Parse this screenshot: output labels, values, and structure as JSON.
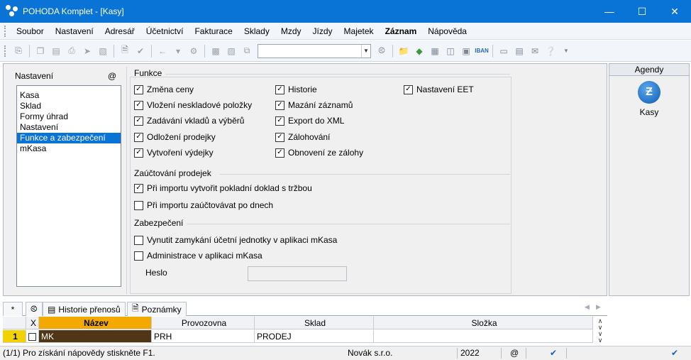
{
  "window": {
    "title": "POHODA Komplet - [Kasy]"
  },
  "menu": [
    "Soubor",
    "Nastavení",
    "Adresář",
    "Účetnictví",
    "Fakturace",
    "Sklady",
    "Mzdy",
    "Jízdy",
    "Majetek",
    "Záznam",
    "Nápověda"
  ],
  "menu_bold_index": 9,
  "left_panel": {
    "header": "Nastavení",
    "at_label": "@",
    "items": [
      "Kasa",
      "Sklad",
      "Formy úhrad",
      "Nastavení",
      "Funkce a zabezpečení",
      "mKasa"
    ],
    "selected_index": 4
  },
  "form": {
    "funkce": {
      "title": "Funkce",
      "options": [
        {
          "label": "Změna ceny",
          "checked": true
        },
        {
          "label": "Vložení neskladové položky",
          "checked": true
        },
        {
          "label": "Zadávání vkladů a výběrů",
          "checked": true
        },
        {
          "label": "Odložení prodejky",
          "checked": true
        },
        {
          "label": "Vytvoření výdejky",
          "checked": true
        },
        {
          "label": "Historie",
          "checked": true
        },
        {
          "label": "Mazání záznamů",
          "checked": true
        },
        {
          "label": "Export do XML",
          "checked": true
        },
        {
          "label": "Zálohování",
          "checked": true
        },
        {
          "label": "Obnovení ze zálohy",
          "checked": true
        },
        {
          "label": "Nastavení EET",
          "checked": true
        }
      ]
    },
    "zauctovani": {
      "title": "Zaúčtování prodejek",
      "options": [
        {
          "label": "Při importu vytvořit pokladní doklad s tržbou",
          "checked": true
        },
        {
          "label": "Při importu zaúčtovávat po dnech",
          "checked": false
        }
      ]
    },
    "zabezpeceni": {
      "title": "Zabezpečení",
      "options": [
        {
          "label": "Vynutit zamykání účetní jednotky v aplikaci mKasa",
          "checked": false
        },
        {
          "label": "Administrace v aplikaci mKasa",
          "checked": false
        }
      ],
      "heslo_label": "Heslo",
      "heslo_value": ""
    }
  },
  "agendy": {
    "header": "Agendy",
    "item_label": "Kasy",
    "item_icon": "z-badge-icon"
  },
  "tabs": {
    "star": "*",
    "historie": "Historie přenosů",
    "poznamky": "Poznámky"
  },
  "grid": {
    "columns": [
      "X",
      "Název",
      "Provozovna",
      "Sklad",
      "Složka"
    ],
    "rows": [
      {
        "num": "1",
        "x": "",
        "nazev": "MK",
        "provozovna": "PRH",
        "sklad": "PRODEJ",
        "slozka": ""
      }
    ]
  },
  "status": {
    "help": "(1/1) Pro získání nápovědy stiskněte F1.",
    "company": "Novák s.r.o.",
    "year": "2022",
    "at": "@"
  }
}
